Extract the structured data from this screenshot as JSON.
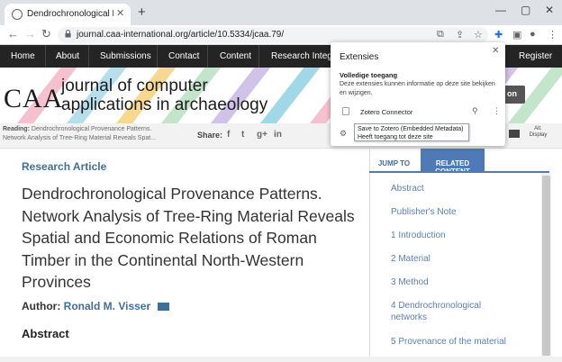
{
  "browser": {
    "tab_title": "Dendrochronological Provenance",
    "tab_close": "✕",
    "new_tab": "+",
    "window_controls": [
      "—",
      "▢",
      "✕"
    ],
    "url": "journal.caa-international.org/article/10.5334/jcaa.79/"
  },
  "site_nav": {
    "items": [
      "Home",
      "About",
      "Submissions",
      "Contact",
      "Content",
      "Research Integrit"
    ],
    "right_item": "Register"
  },
  "banner": {
    "logo": "CAA",
    "journal_line1": "journal of computer",
    "journal_line2": "applications in archaeology",
    "partial_button": "on"
  },
  "reading_bar": {
    "label": "Reading:",
    "text_line1": "Dendrochronological Provenance Patterns.",
    "text_line2": "Network Analysis of Tree-Ring Material Reveals Spat...",
    "share_label": "Share:",
    "social": [
      "f",
      "t",
      "g+",
      "in"
    ],
    "alt_display_line1": "Alt.",
    "alt_display_line2": "Display"
  },
  "article": {
    "kind": "Research Article",
    "title_lines": [
      "Dendrochronological Provenance Patterns.",
      "Network Analysis of Tree-Ring Material Reveals",
      "Spatial and Economic Relations of Roman",
      "Timber in the Continental North-Western",
      "Provinces"
    ],
    "author_label": "Author:",
    "author_name": "Ronald M. Visser",
    "abstract_heading": "Abstract"
  },
  "sidebar": {
    "tab_jump": "JUMP TO",
    "tab_related": "RELATED CONTENT",
    "toc": [
      "Abstract",
      "Publisher's Note",
      "1 Introduction",
      "2 Material",
      "3 Method",
      "4 Dendrochronological networks",
      "5 Provenance of the material"
    ]
  },
  "extensions_popup": {
    "title": "Extensies",
    "close": "✕",
    "section": "Volledige toegang",
    "description": "Deze extensies kunnen informatie op deze site bekijken en wijzigen.",
    "extension_name": "Zotero Connector",
    "tooltip_line1": "Save to Zotero (Embedded Metadata)",
    "tooltip_line2": "Heeft toegang tot deze site"
  },
  "colors": {
    "nav_bg": "#242424",
    "link_blue": "#3f6f96",
    "tab_active": "#4f7ab8",
    "stripes": [
      "#f3b6c6",
      "#a9d8e8",
      "#f5d17a",
      "#b8e0c2",
      "#c9b7e6",
      "#8fd1e3"
    ]
  },
  "icons": [
    "globe-icon",
    "lock-icon",
    "translate-icon",
    "share-icon",
    "star-icon",
    "puzzle-icon",
    "sidepanel-icon",
    "profile-icon",
    "menu-icon",
    "pin-icon",
    "gear-icon",
    "mail-icon"
  ]
}
